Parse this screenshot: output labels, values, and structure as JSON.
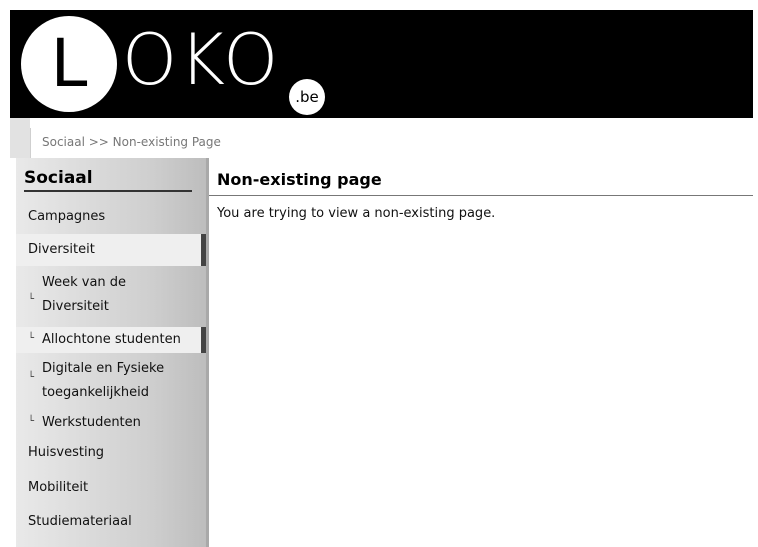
{
  "logo": {
    "circle_letter": "L",
    "rest": "OKO",
    "tld": ".be"
  },
  "breadcrumb": "Sociaal >> Non-existing Page",
  "sidebar": {
    "title": "Sociaal",
    "items": [
      {
        "label": "Campagnes",
        "level": 0,
        "active": false
      },
      {
        "label": "Diversiteit",
        "level": 0,
        "active": true
      },
      {
        "label": "Week van de Diversiteit",
        "level": 1,
        "active": false
      },
      {
        "label": "Allochtone studenten",
        "level": 1,
        "active": true
      },
      {
        "label": "Digitale en Fysieke toegankelijkheid",
        "level": 1,
        "active": false
      },
      {
        "label": "Werkstudenten",
        "level": 1,
        "active": false
      },
      {
        "label": "Huisvesting",
        "level": 0,
        "active": false
      },
      {
        "label": "Mobiliteit",
        "level": 0,
        "active": false
      },
      {
        "label": "Studiemateriaal",
        "level": 0,
        "active": false
      }
    ]
  },
  "content": {
    "title": "Non-existing page",
    "message": "You are trying to view a non-existing page."
  }
}
